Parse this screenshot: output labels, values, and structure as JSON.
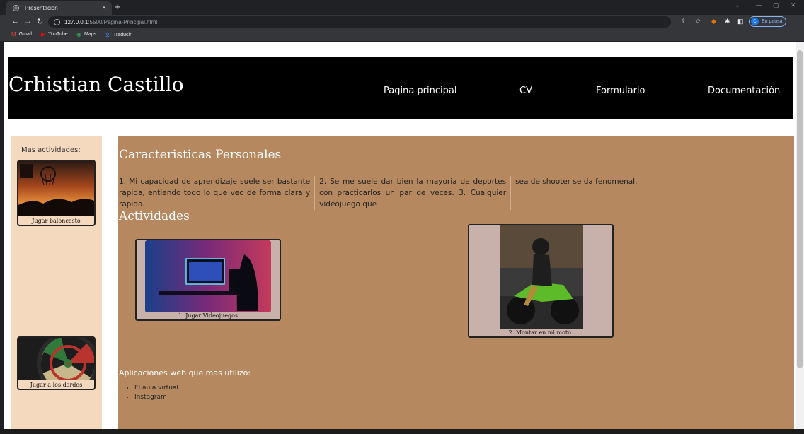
{
  "browser": {
    "tab_title": "Presentación",
    "tab_close": "×",
    "new_tab": "+",
    "url_host": "127.0.0.1",
    "url_path": ":5500/Pagina-Principal.html",
    "profile_initial": "C",
    "profile_status": "En pausa",
    "bookmarks": [
      {
        "label": "Gmail",
        "icon": "gmail-icon",
        "glyph": "M",
        "color": "#ea4335"
      },
      {
        "label": "YouTube",
        "icon": "youtube-icon",
        "glyph": "▶",
        "color": "#ff0000"
      },
      {
        "label": "Maps",
        "icon": "maps-icon",
        "glyph": "◉",
        "color": "#34a853"
      },
      {
        "label": "Traducir",
        "icon": "translate-icon",
        "glyph": "文",
        "color": "#4285f4"
      }
    ]
  },
  "site": {
    "title": "Crhistian Castillo",
    "nav": [
      "Pagina principal",
      "CV",
      "Formulario",
      "Documentación"
    ]
  },
  "sidebar": {
    "title": "Mas actividades:",
    "cards": [
      {
        "caption": "Jugar baloncesto"
      },
      {
        "caption": "Jugar a los dardos"
      }
    ]
  },
  "main": {
    "characteristics_title": "Caracteristicas Personales",
    "columns": [
      "1. Mi capacidad de aprendizaje suele ser bastante rapida, entiendo todo lo que veo de forma clara y rapida.",
      "2. Se me suele dar bien la mayoria de deportes con practicarlos un par de veces. 3. Cualquier videojuego que",
      "sea de shooter se da fenomenal."
    ],
    "activities_title": "Actividades",
    "photos": [
      {
        "caption": "1. Jugar Videojuegos"
      },
      {
        "caption": "2. Montar en mi moto."
      }
    ],
    "apps_title": "Aplicaciones web que mas utilizo:",
    "apps": [
      "El aula virtual",
      "Instagram"
    ]
  },
  "colors": {
    "header_bg": "#000000",
    "sidebar_bg": "#f4d9bf",
    "main_bg": "#b58860",
    "photo_card_bg": "#c9b1ab"
  }
}
